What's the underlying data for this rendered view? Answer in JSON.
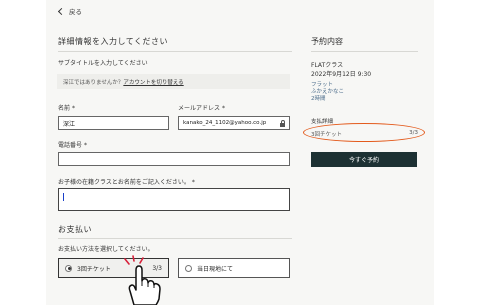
{
  "nav": {
    "back_label": "戻る"
  },
  "form": {
    "section_title": "詳細情報を入力してください",
    "subtitle": "サブタイトルを入力してください",
    "notice": {
      "text": "深江ではありませんか？",
      "link": "アカウントを切り替える"
    },
    "name": {
      "label": "名前",
      "required": "*",
      "value": "深江"
    },
    "email": {
      "label": "メールアドレス",
      "required": "*",
      "value": "kanako_24_1102@yahoo.co.jp"
    },
    "phone": {
      "label": "電話番号",
      "required": "*",
      "value": ""
    },
    "child": {
      "label": "お子様の在籍クラスとお名前をご記入ください。",
      "required": "*",
      "value": ""
    }
  },
  "payment": {
    "section_title": "お支払い",
    "prompt": "お支払い方法を選択してください。",
    "options": [
      {
        "label": "3回チケット",
        "count": "3/3",
        "selected": true
      },
      {
        "label": "当日現地にて",
        "selected": false
      }
    ]
  },
  "sidebar": {
    "title": "予約内容",
    "class_name": "FLATクラス",
    "datetime": "2022年9月12日 9:30",
    "teacher_1": "フラット",
    "teacher_2": "ふかえかなこ",
    "duration": "2時間",
    "payment_detail_label": "支払詳細",
    "ticket_name": "3回チケット",
    "ticket_count": "3/3",
    "reserve_button": "今すぐ予約"
  },
  "colors": {
    "button_bg": "#1d3133",
    "annotation_orange": "#e35a1c",
    "annotation_red": "#d8203a",
    "caret_blue": "#1a3fc9"
  }
}
